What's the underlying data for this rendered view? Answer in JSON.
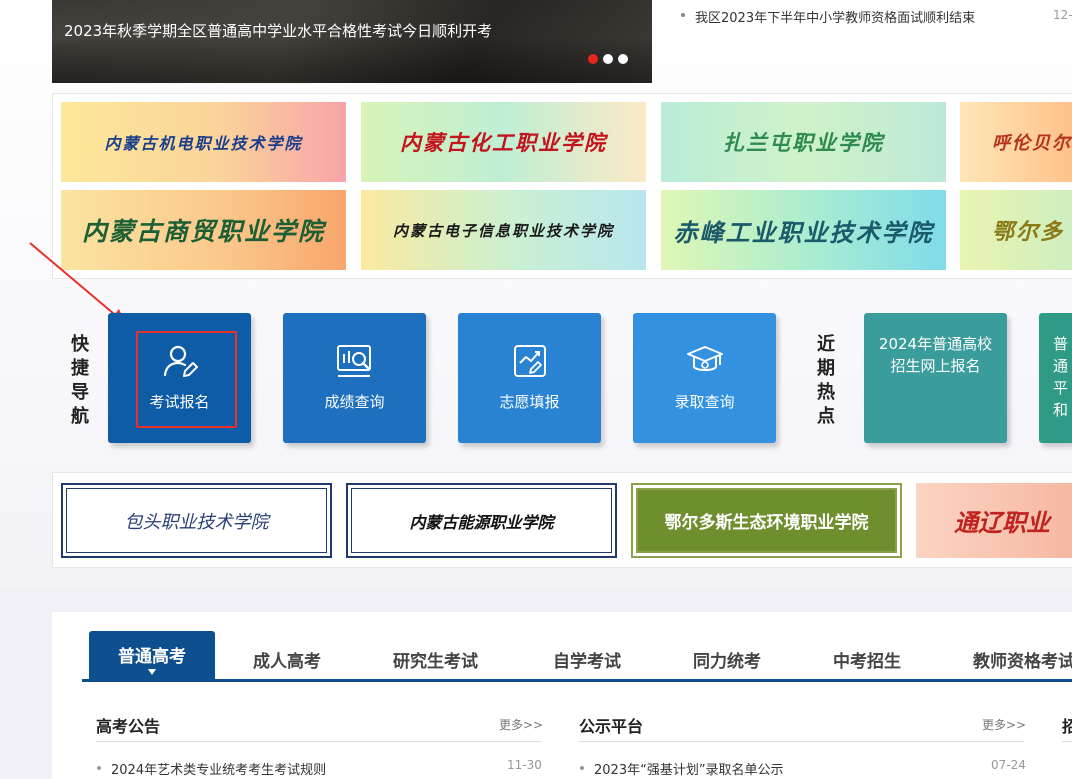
{
  "carousel": {
    "caption": "2023年秋季学期全区普通高中学业水平合格性考试今日顺利开考",
    "dots": 3,
    "active_dot": 1
  },
  "top_news": {
    "title": "我区2023年下半年中小学教师资格面试顺利结束",
    "date": "12-"
  },
  "college_banners": [
    {
      "name": "内蒙古机电职业技术学院",
      "color": "#1a3e8c"
    },
    {
      "name": "内蒙古化工职业学院",
      "color": "#c2141c"
    },
    {
      "name": "扎兰屯职业学院",
      "color": "#2e8a4e"
    },
    {
      "name": "呼伦贝尔",
      "color": "#b5321b"
    },
    {
      "name": "内蒙古商贸职业学院",
      "color": "#1d5f34"
    },
    {
      "name": "内蒙古电子信息职业技术学院",
      "color": "#1a1a1a"
    },
    {
      "name": "赤峰工业职业技术学院",
      "color": "#1a5a6a"
    },
    {
      "name": "鄂尔多",
      "color": "#8a7a18"
    }
  ],
  "quick_nav": {
    "label": [
      "快",
      "捷",
      "导",
      "航"
    ],
    "buttons": [
      {
        "label": "考试报名",
        "icon": "user-edit-icon",
        "color": "#0e5ba6"
      },
      {
        "label": "成绩查询",
        "icon": "chart-search-icon",
        "color": "#1e6fbe"
      },
      {
        "label": "志愿填报",
        "icon": "trend-edit-icon",
        "color": "#2983d2"
      },
      {
        "label": "录取查询",
        "icon": "graduation-cap-icon",
        "color": "#3391e0"
      }
    ]
  },
  "hot_topics": {
    "label": [
      "近",
      "期",
      "热",
      "点"
    ],
    "items": [
      {
        "text": "2024年普通高校招生网上报名",
        "color": "#3a9c9b"
      },
      {
        "text": "普通 平 和",
        "color": "#2f9a86"
      }
    ]
  },
  "bottom_banners": [
    {
      "name": "包头职业技术学院",
      "color": "#2a3f78",
      "border": "#203a6e"
    },
    {
      "name": "内蒙古能源职业学院",
      "color": "#111111",
      "border": "#203a6e"
    },
    {
      "name": "鄂尔多斯生态环境职业学院",
      "color": "#ffffff",
      "border": "#8aa04a"
    },
    {
      "name": "通辽职业",
      "color": "#c0231f",
      "border": "#f2b49a"
    }
  ],
  "tabs": [
    "普通高考",
    "成人高考",
    "研究生考试",
    "自学考试",
    "同力统考",
    "中考招生",
    "教师资格考试"
  ],
  "sections": [
    {
      "title": "高考公告",
      "more": "更多>>",
      "item": "2024年艺术类专业统考考生考试规则",
      "date": "11-30"
    },
    {
      "title": "公示平台",
      "more": "更多>>",
      "item": "2023年“强基计划”录取名单公示",
      "date": "07-24"
    },
    {
      "title": "招",
      "more": "",
      "item": "",
      "date": ""
    }
  ]
}
